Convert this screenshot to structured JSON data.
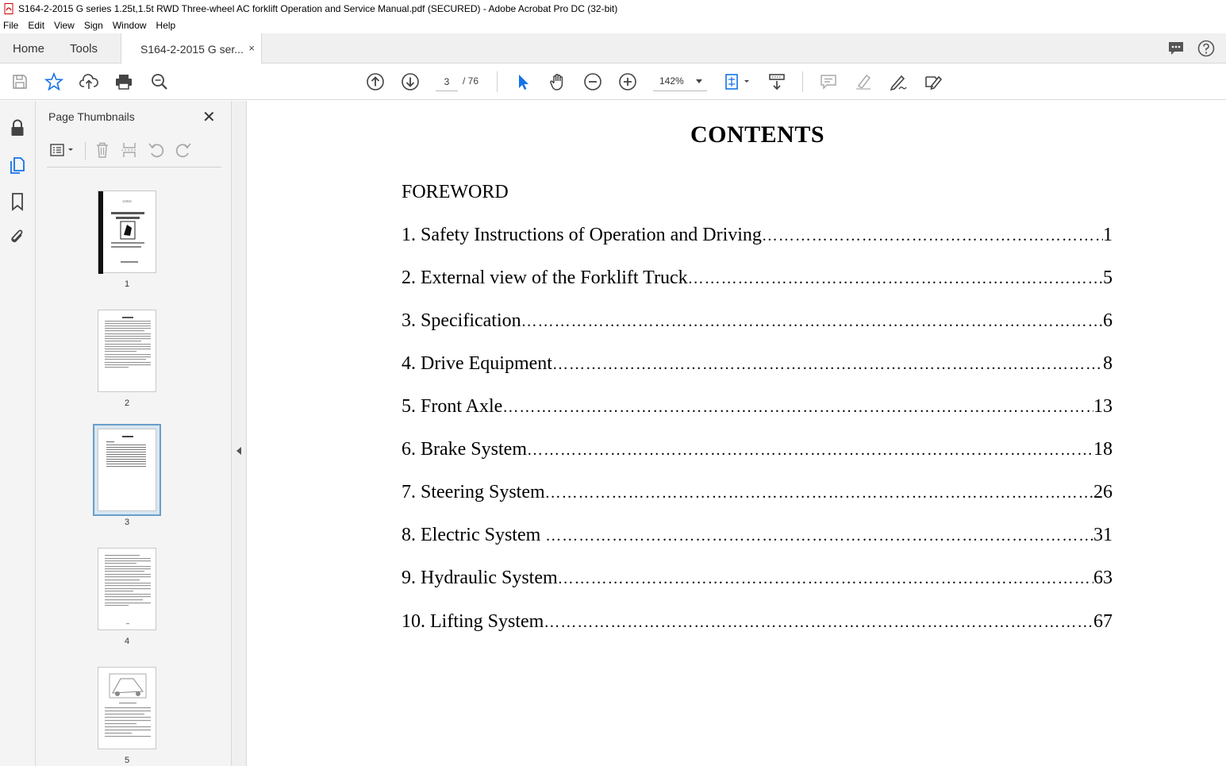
{
  "window": {
    "title": "S164-2-2015 G series 1.25t,1.5t RWD Three-wheel AC forklift Operation and Service Manual.pdf (SECURED) - Adobe Acrobat Pro DC (32-bit)"
  },
  "menu": [
    "File",
    "Edit",
    "View",
    "Sign",
    "Window",
    "Help"
  ],
  "tabs": {
    "home": "Home",
    "tools": "Tools",
    "doc": "S164-2-2015 G ser...",
    "close": "×"
  },
  "toolbar": {
    "current_page": "3",
    "total_pages": "/ 76",
    "zoom": "142%"
  },
  "panel": {
    "title": "Page Thumbnails",
    "close": "✕"
  },
  "thumbnails": [
    {
      "num": "1"
    },
    {
      "num": "2"
    },
    {
      "num": "3"
    },
    {
      "num": "4"
    },
    {
      "num": "5"
    }
  ],
  "document": {
    "heading": "CONTENTS",
    "foreword": "FOREWORD",
    "entries": [
      {
        "label": "1. Safety Instructions of Operation and Driving",
        "page": "1"
      },
      {
        "label": "2. External view of the Forklift Truck",
        "page": "5"
      },
      {
        "label": "3. Specification",
        "page": "6"
      },
      {
        "label": "4. Drive Equipment",
        "page": "8"
      },
      {
        "label": "5. Front Axle",
        "page": "13"
      },
      {
        "label": "6. Brake System",
        "page": "18"
      },
      {
        "label": "7. Steering System",
        "page": "26"
      },
      {
        "label": "8. Electric System ",
        "page": "31"
      },
      {
        "label": "9. Hydraulic System",
        "page": "63"
      },
      {
        "label": "10. Lifting System",
        "page": "67"
      }
    ]
  },
  "colors": {
    "accent_blue": "#1473e6",
    "selection": "#6a9fc9"
  },
  "icons": [
    "pdf-icon",
    "chat-icon",
    "help-icon",
    "save-icon",
    "star-icon",
    "upload-icon",
    "print-icon",
    "zoom-search-icon",
    "page-up-icon",
    "page-down-icon",
    "select-arrow-icon",
    "hand-icon",
    "zoom-out-icon",
    "zoom-in-icon",
    "fit-page-icon",
    "scroll-mode-icon",
    "comment-icon",
    "highlight-icon",
    "sign-icon",
    "fill-sign-icon",
    "lock-icon",
    "pages-icon",
    "bookmark-icon",
    "attachment-icon",
    "options-icon",
    "delete-icon",
    "extract-icon",
    "rotate-left-icon",
    "rotate-right-icon"
  ]
}
